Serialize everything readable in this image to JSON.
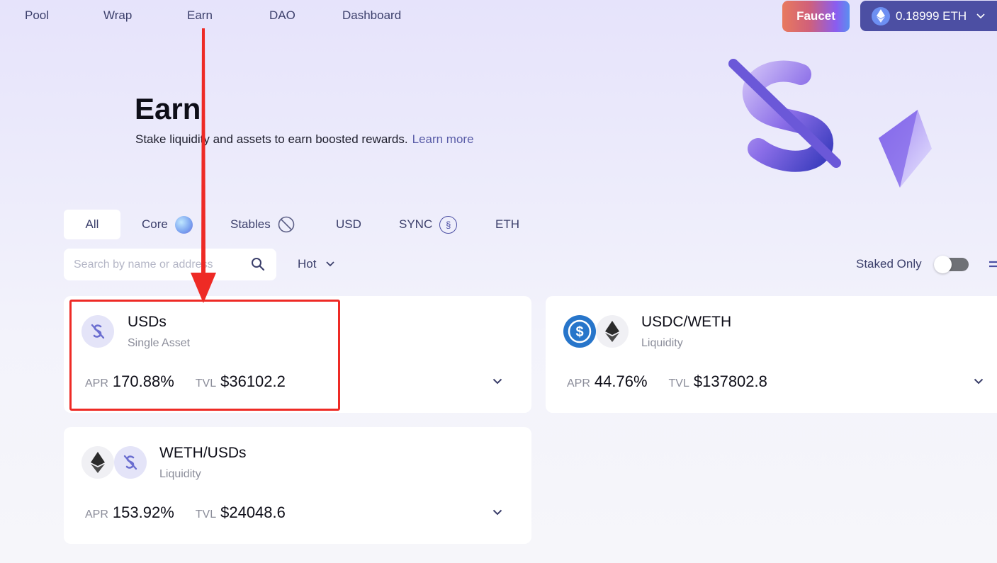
{
  "nav": {
    "items": [
      "Pool",
      "Wrap",
      "Earn",
      "DAO",
      "Dashboard"
    ],
    "faucet_label": "Faucet",
    "wallet_balance": "0.18999 ETH"
  },
  "hero": {
    "title": "Earn",
    "subtitle": "Stake liquidity and assets to earn boosted rewards.",
    "learn_more": "Learn more"
  },
  "tabs": [
    {
      "label": "All",
      "icon": null
    },
    {
      "label": "Core",
      "icon": "core-gradient-icon"
    },
    {
      "label": "Stables",
      "icon": "stables-slash-icon"
    },
    {
      "label": "USD",
      "icon": null
    },
    {
      "label": "SYNC",
      "icon": "sync-icon"
    },
    {
      "label": "ETH",
      "icon": null
    }
  ],
  "search": {
    "placeholder": "Search by name or address"
  },
  "sort": {
    "selected": "Hot"
  },
  "staked_only": {
    "label": "Staked Only",
    "enabled": false
  },
  "pools": [
    {
      "name": "USDs",
      "type": "Single Asset",
      "apr_label": "APR",
      "apr": "170.88%",
      "tvl_label": "TVL",
      "tvl": "$36102.2",
      "tokens": [
        "usds"
      ]
    },
    {
      "name": "USDC/WETH",
      "type": "Liquidity",
      "apr_label": "APR",
      "apr": "44.76%",
      "tvl_label": "TVL",
      "tvl": "$137802.8",
      "tokens": [
        "usdc",
        "eth"
      ]
    },
    {
      "name": "WETH/USDs",
      "type": "Liquidity",
      "apr_label": "APR",
      "apr": "153.92%",
      "tvl_label": "TVL",
      "tvl": "$24048.6",
      "tokens": [
        "eth",
        "usds"
      ]
    }
  ],
  "colors": {
    "accent": "#4c4fa3",
    "annotation_red": "#ee2a25",
    "usdc_blue": "#2775ca"
  }
}
